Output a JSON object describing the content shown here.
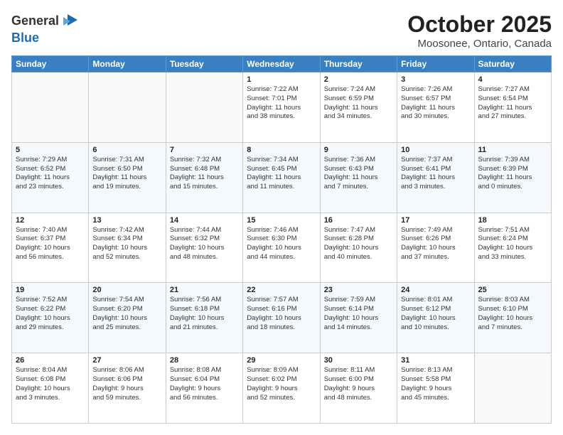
{
  "header": {
    "logo_line1": "General",
    "logo_line2": "Blue",
    "month": "October 2025",
    "location": "Moosonee, Ontario, Canada"
  },
  "weekdays": [
    "Sunday",
    "Monday",
    "Tuesday",
    "Wednesday",
    "Thursday",
    "Friday",
    "Saturday"
  ],
  "rows": [
    [
      {
        "day": "",
        "info": ""
      },
      {
        "day": "",
        "info": ""
      },
      {
        "day": "",
        "info": ""
      },
      {
        "day": "1",
        "info": "Sunrise: 7:22 AM\nSunset: 7:01 PM\nDaylight: 11 hours\nand 38 minutes."
      },
      {
        "day": "2",
        "info": "Sunrise: 7:24 AM\nSunset: 6:59 PM\nDaylight: 11 hours\nand 34 minutes."
      },
      {
        "day": "3",
        "info": "Sunrise: 7:26 AM\nSunset: 6:57 PM\nDaylight: 11 hours\nand 30 minutes."
      },
      {
        "day": "4",
        "info": "Sunrise: 7:27 AM\nSunset: 6:54 PM\nDaylight: 11 hours\nand 27 minutes."
      }
    ],
    [
      {
        "day": "5",
        "info": "Sunrise: 7:29 AM\nSunset: 6:52 PM\nDaylight: 11 hours\nand 23 minutes."
      },
      {
        "day": "6",
        "info": "Sunrise: 7:31 AM\nSunset: 6:50 PM\nDaylight: 11 hours\nand 19 minutes."
      },
      {
        "day": "7",
        "info": "Sunrise: 7:32 AM\nSunset: 6:48 PM\nDaylight: 11 hours\nand 15 minutes."
      },
      {
        "day": "8",
        "info": "Sunrise: 7:34 AM\nSunset: 6:45 PM\nDaylight: 11 hours\nand 11 minutes."
      },
      {
        "day": "9",
        "info": "Sunrise: 7:36 AM\nSunset: 6:43 PM\nDaylight: 11 hours\nand 7 minutes."
      },
      {
        "day": "10",
        "info": "Sunrise: 7:37 AM\nSunset: 6:41 PM\nDaylight: 11 hours\nand 3 minutes."
      },
      {
        "day": "11",
        "info": "Sunrise: 7:39 AM\nSunset: 6:39 PM\nDaylight: 11 hours\nand 0 minutes."
      }
    ],
    [
      {
        "day": "12",
        "info": "Sunrise: 7:40 AM\nSunset: 6:37 PM\nDaylight: 10 hours\nand 56 minutes."
      },
      {
        "day": "13",
        "info": "Sunrise: 7:42 AM\nSunset: 6:34 PM\nDaylight: 10 hours\nand 52 minutes."
      },
      {
        "day": "14",
        "info": "Sunrise: 7:44 AM\nSunset: 6:32 PM\nDaylight: 10 hours\nand 48 minutes."
      },
      {
        "day": "15",
        "info": "Sunrise: 7:46 AM\nSunset: 6:30 PM\nDaylight: 10 hours\nand 44 minutes."
      },
      {
        "day": "16",
        "info": "Sunrise: 7:47 AM\nSunset: 6:28 PM\nDaylight: 10 hours\nand 40 minutes."
      },
      {
        "day": "17",
        "info": "Sunrise: 7:49 AM\nSunset: 6:26 PM\nDaylight: 10 hours\nand 37 minutes."
      },
      {
        "day": "18",
        "info": "Sunrise: 7:51 AM\nSunset: 6:24 PM\nDaylight: 10 hours\nand 33 minutes."
      }
    ],
    [
      {
        "day": "19",
        "info": "Sunrise: 7:52 AM\nSunset: 6:22 PM\nDaylight: 10 hours\nand 29 minutes."
      },
      {
        "day": "20",
        "info": "Sunrise: 7:54 AM\nSunset: 6:20 PM\nDaylight: 10 hours\nand 25 minutes."
      },
      {
        "day": "21",
        "info": "Sunrise: 7:56 AM\nSunset: 6:18 PM\nDaylight: 10 hours\nand 21 minutes."
      },
      {
        "day": "22",
        "info": "Sunrise: 7:57 AM\nSunset: 6:16 PM\nDaylight: 10 hours\nand 18 minutes."
      },
      {
        "day": "23",
        "info": "Sunrise: 7:59 AM\nSunset: 6:14 PM\nDaylight: 10 hours\nand 14 minutes."
      },
      {
        "day": "24",
        "info": "Sunrise: 8:01 AM\nSunset: 6:12 PM\nDaylight: 10 hours\nand 10 minutes."
      },
      {
        "day": "25",
        "info": "Sunrise: 8:03 AM\nSunset: 6:10 PM\nDaylight: 10 hours\nand 7 minutes."
      }
    ],
    [
      {
        "day": "26",
        "info": "Sunrise: 8:04 AM\nSunset: 6:08 PM\nDaylight: 10 hours\nand 3 minutes."
      },
      {
        "day": "27",
        "info": "Sunrise: 8:06 AM\nSunset: 6:06 PM\nDaylight: 9 hours\nand 59 minutes."
      },
      {
        "day": "28",
        "info": "Sunrise: 8:08 AM\nSunset: 6:04 PM\nDaylight: 9 hours\nand 56 minutes."
      },
      {
        "day": "29",
        "info": "Sunrise: 8:09 AM\nSunset: 6:02 PM\nDaylight: 9 hours\nand 52 minutes."
      },
      {
        "day": "30",
        "info": "Sunrise: 8:11 AM\nSunset: 6:00 PM\nDaylight: 9 hours\nand 48 minutes."
      },
      {
        "day": "31",
        "info": "Sunrise: 8:13 AM\nSunset: 5:58 PM\nDaylight: 9 hours\nand 45 minutes."
      },
      {
        "day": "",
        "info": ""
      }
    ]
  ]
}
